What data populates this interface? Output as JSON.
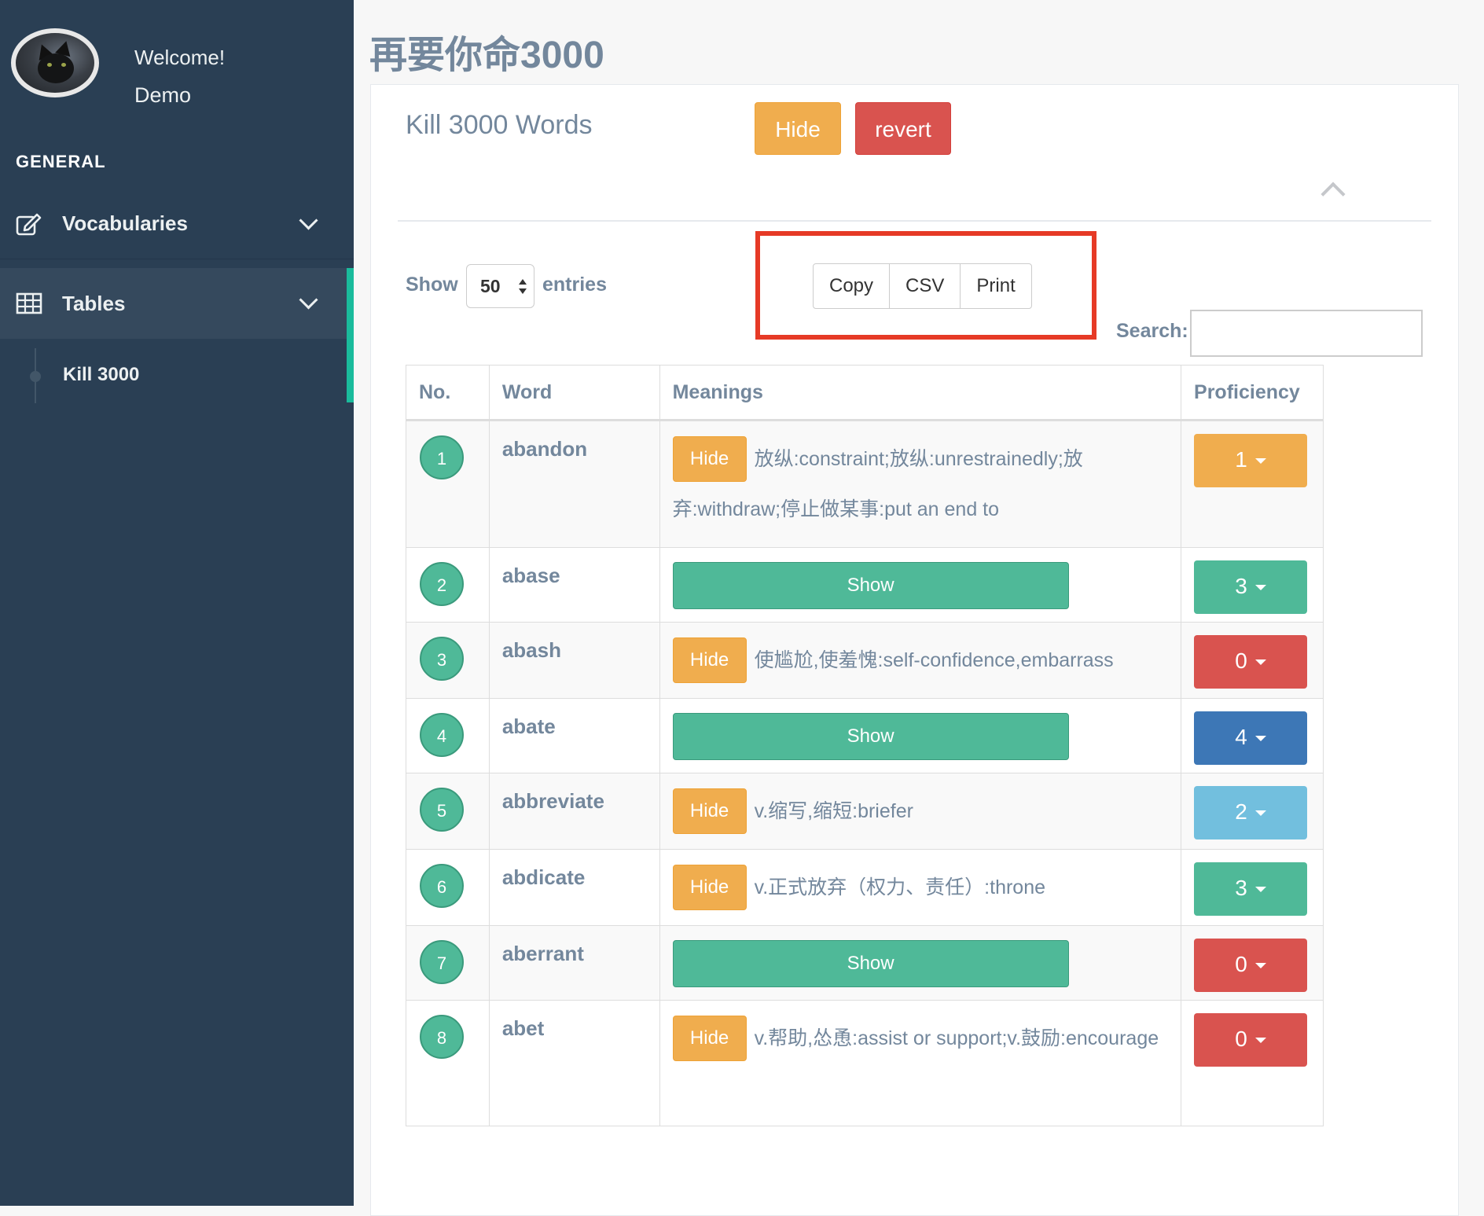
{
  "sidebar": {
    "welcome": "Welcome!",
    "username": "Demo",
    "section": "GENERAL",
    "items": [
      {
        "label": "Vocabularies",
        "icon": "edit-icon"
      },
      {
        "label": "Tables",
        "icon": "table-icon"
      }
    ],
    "submenu": [
      {
        "label": "Kill 3000"
      }
    ]
  },
  "page_title": "再要你命3000",
  "panel": {
    "title": "Kill 3000 Words",
    "hide_label": "Hide",
    "revert_label": "revert"
  },
  "table_controls": {
    "show_label": "Show",
    "entries_value": "50",
    "entries_label": "entries",
    "buttons": [
      "Copy",
      "CSV",
      "Print"
    ],
    "search_label": "Search:",
    "search_value": ""
  },
  "table": {
    "headers": [
      "No.",
      "Word",
      "Meanings",
      "Proficiency"
    ],
    "hide_label": "Hide",
    "show_label": "Show",
    "rows": [
      {
        "no": "1",
        "word": "abandon",
        "state": "hidden",
        "meaning": "放纵:constraint;放纵:unrestrainedly;放弃:withdraw;停止做某事:put an end to",
        "proficiency": "1",
        "prof_color": "#f0ad4e"
      },
      {
        "no": "2",
        "word": "abase",
        "state": "shown",
        "meaning": "",
        "proficiency": "3",
        "prof_color": "#4fb998"
      },
      {
        "no": "3",
        "word": "abash",
        "state": "hidden",
        "meaning": "使尴尬,使羞愧:self-confidence,embarrass",
        "proficiency": "0",
        "prof_color": "#d9534f"
      },
      {
        "no": "4",
        "word": "abate",
        "state": "shown",
        "meaning": "",
        "proficiency": "4",
        "prof_color": "#3d77b6"
      },
      {
        "no": "5",
        "word": "abbreviate",
        "state": "hidden",
        "meaning": "v.缩写,缩短:briefer",
        "proficiency": "2",
        "prof_color": "#72bfde"
      },
      {
        "no": "6",
        "word": "abdicate",
        "state": "hidden",
        "meaning": "v.正式放弃（权力、责任）:throne",
        "proficiency": "3",
        "prof_color": "#4fb998"
      },
      {
        "no": "7",
        "word": "aberrant",
        "state": "shown",
        "meaning": "",
        "proficiency": "0",
        "prof_color": "#d9534f"
      },
      {
        "no": "8",
        "word": "abet",
        "state": "hidden",
        "meaning": "v.帮助,怂恿:assist or support;v.鼓励:encourage",
        "proficiency": "0",
        "prof_color": "#d9534f"
      }
    ]
  }
}
